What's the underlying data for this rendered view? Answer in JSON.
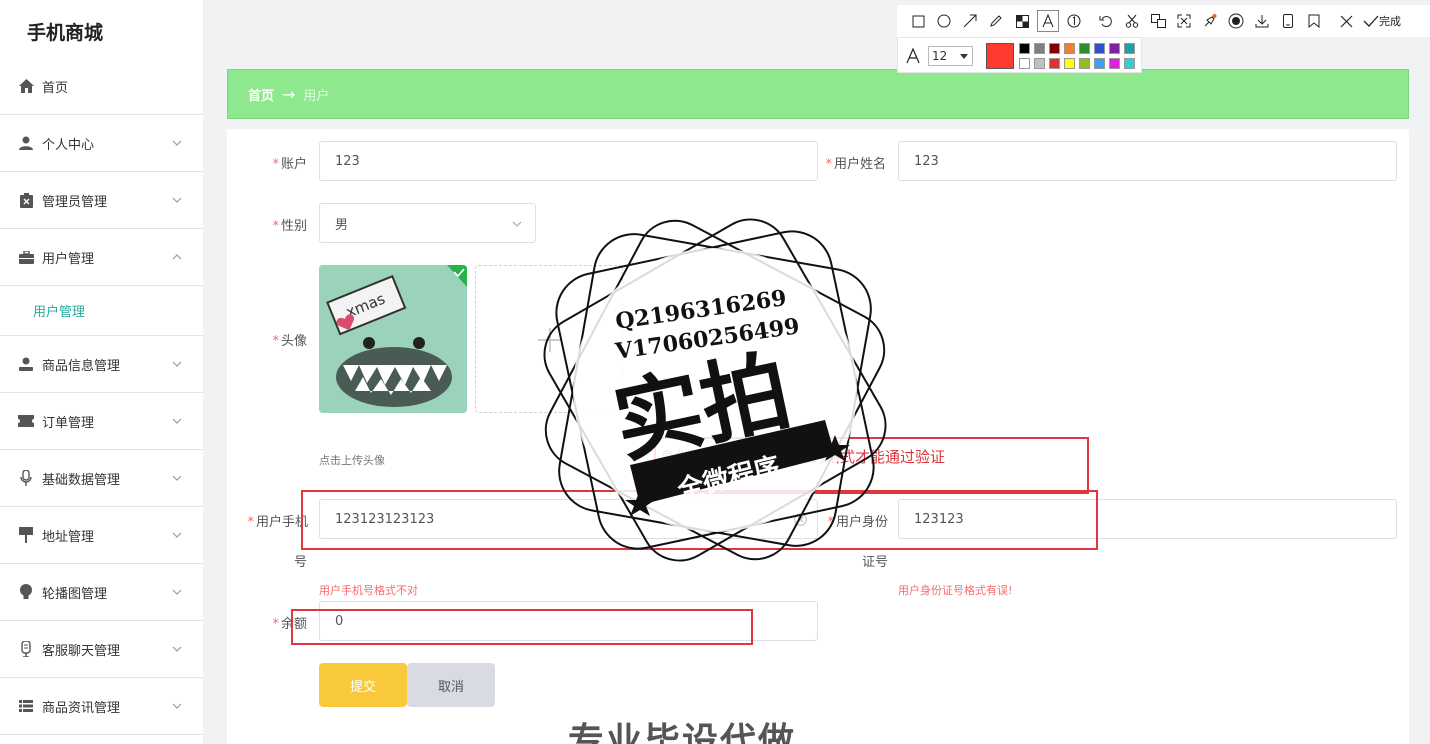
{
  "app": {
    "title": "手机商城"
  },
  "sidebar": {
    "items": [
      {
        "label": "首页",
        "icon": "home-icon"
      },
      {
        "label": "个人中心",
        "icon": "user-icon"
      },
      {
        "label": "管理员管理",
        "icon": "admin-icon"
      },
      {
        "label": "用户管理",
        "icon": "briefcase-icon",
        "expanded": true,
        "children": [
          "用户管理"
        ]
      },
      {
        "label": "商品信息管理",
        "icon": "person-icon"
      },
      {
        "label": "订单管理",
        "icon": "ticket-icon"
      },
      {
        "label": "基础数据管理",
        "icon": "mic-icon"
      },
      {
        "label": "地址管理",
        "icon": "sign-icon"
      },
      {
        "label": "轮播图管理",
        "icon": "bulb-icon"
      },
      {
        "label": "客服聊天管理",
        "icon": "chat-icon"
      },
      {
        "label": "商品资讯管理",
        "icon": "list-icon"
      }
    ]
  },
  "breadcrumb": {
    "home": "首页",
    "arrow": "→",
    "current": "用户"
  },
  "form": {
    "account_label": "账户",
    "account_value": "123",
    "username_label": "用户姓名",
    "username_value": "123",
    "gender_label": "性别",
    "gender_value": "男",
    "avatar_label": "头像",
    "avatar_hint": "点击上传头像",
    "avatar_sign_text": "xmas",
    "phone_label_line1": "用户手机",
    "phone_label_line2": "号",
    "phone_value": "123123123123",
    "phone_error": "用户手机号格式不对",
    "idcard_label_line1": "用户身份",
    "idcard_label_line2": "证号",
    "idcard_value": "123123",
    "idcard_error": "用户身份证号格式有误!",
    "balance_label": "余额",
    "balance_value": "0",
    "required_mark": "*",
    "submit_label": "提交",
    "cancel_label": "取消"
  },
  "annotation": {
    "text": "身份证号必须输入正确的格式才能通过验证"
  },
  "stamp": {
    "qq": "Q2196316269",
    "vx": "V17060256499",
    "main": "实拍",
    "ribbon": "全微程序"
  },
  "watermark_bottom": "专业毕设代做",
  "toolbar": {
    "font_size": "12",
    "done_label": "完成",
    "colors": [
      "#000000",
      "#808080",
      "#800000",
      "#f08030",
      "#2e8b2e",
      "#3050d0",
      "#8020a0",
      "#20a0a0",
      "#ffffff",
      "#c0c0c0",
      "#e03030",
      "#ffff00",
      "#90c020",
      "#40a0f0",
      "#e020e0",
      "#30d0d0"
    ],
    "active_color": "#ff3b30"
  }
}
